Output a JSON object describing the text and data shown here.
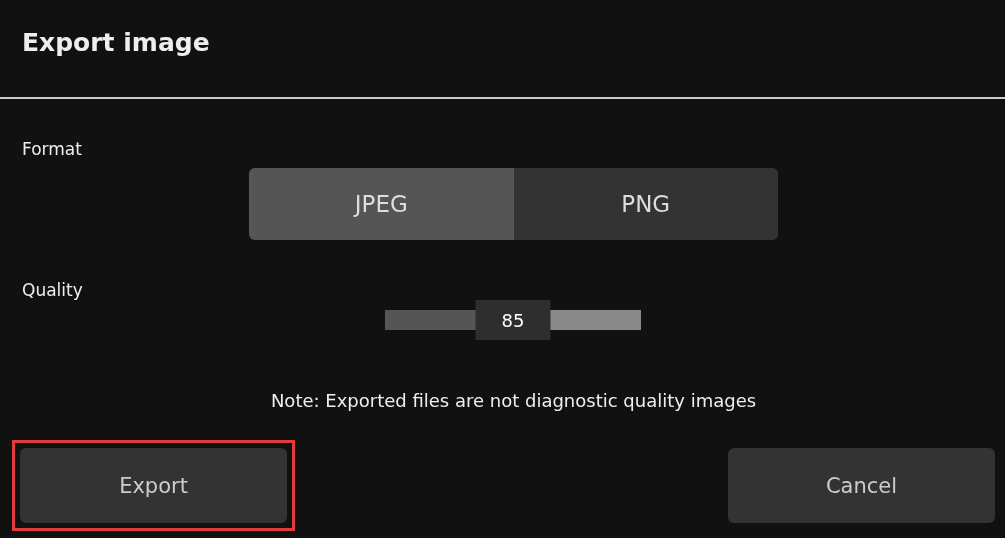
{
  "dialog": {
    "title": "Export image"
  },
  "format": {
    "label": "Format",
    "options": [
      {
        "label": "JPEG",
        "selected": true
      },
      {
        "label": "PNG",
        "selected": false
      }
    ]
  },
  "quality": {
    "label": "Quality",
    "level": 0.5,
    "reading": "85"
  },
  "note": "Note: Exported files are not diagnostic quality images",
  "buttons": [
    {
      "label": "Export",
      "highlighted": true
    },
    {
      "label": "Cancel",
      "highlighted": false
    }
  ]
}
